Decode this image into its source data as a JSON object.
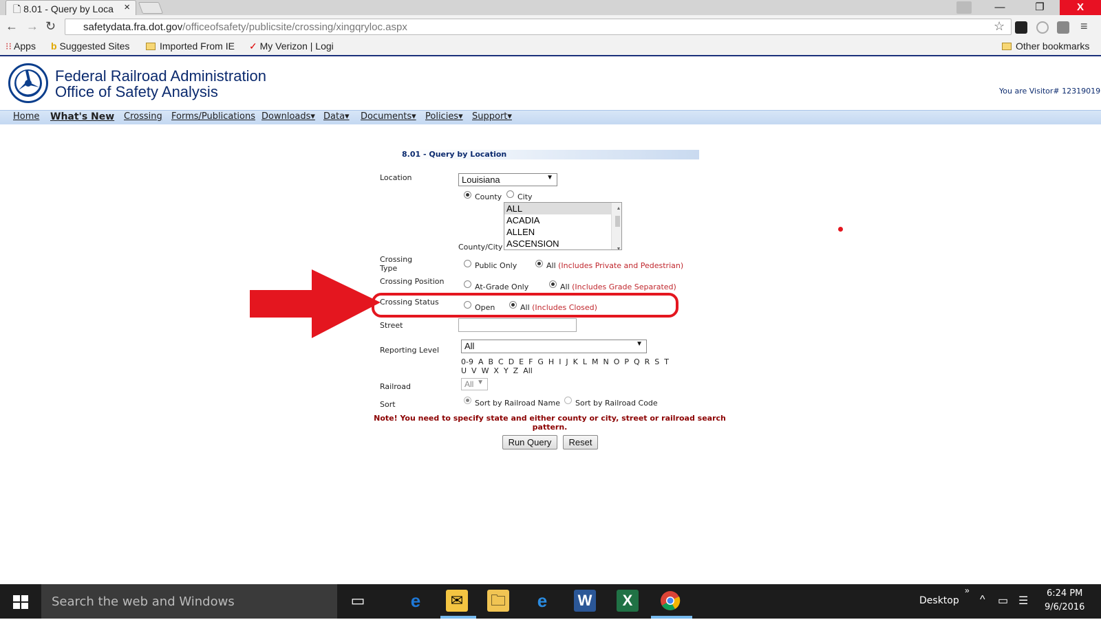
{
  "browser": {
    "tab_title": "8.01 - Query by Loca",
    "tab_close": "×",
    "url_host": "safetydata.fra.dot.gov",
    "url_path": "/officeofsafety/publicsite/crossing/xingqryloc.aspx",
    "bookmarks": [
      "Apps",
      "Suggested Sites",
      "Imported From IE",
      "My Verizon | Logi",
      "Other bookmarks"
    ],
    "win_minimize": "—",
    "win_restore": "❐",
    "win_close": "X"
  },
  "site": {
    "title_line1": "Federal Railroad Administration",
    "title_line2": "Office of Safety Analysis",
    "visitor": "You are Visitor# 12319019",
    "menu": [
      "Home",
      "What's New",
      "Crossing",
      "Forms/Publications",
      "Downloads▾",
      "Data▾",
      "Documents▾",
      "Policies▾",
      "Support▾"
    ]
  },
  "form": {
    "title": "8.01 - Query by Location",
    "location_label": "Location",
    "location_value": "Louisiana",
    "county_label": "County",
    "city_label": "City",
    "county_city_label": "County/City",
    "county_options": [
      "ALL",
      "ACADIA",
      "ALLEN",
      "ASCENSION"
    ],
    "crossing_type_label_1": "Crossing",
    "crossing_type_label_2": "Type",
    "public_only": "Public Only",
    "all_label": "All",
    "type_note": "(Includes Private and Pedestrian)",
    "crossing_position_label": "Crossing Position",
    "at_grade_only": "At-Grade Only",
    "position_note": "(Includes Grade Separated)",
    "crossing_status_label": "Crossing Status",
    "open_label": "Open",
    "status_note": "(Includes Closed)",
    "street_label": "Street",
    "reporting_level_label": "Reporting Level",
    "reporting_level_value": "All",
    "alpha_line1": "0-9  A  B  C  D  E  F  G  H  I  J  K  L  M  N  O  P  Q  R  S  T",
    "alpha_line2": "U  V  W  X  Y  Z  All",
    "railroad_label": "Railroad",
    "railroad_value": "All",
    "sort_label": "Sort",
    "sort_name": "Sort by Railroad Name",
    "sort_code": "Sort by Railroad Code",
    "note_line1": "Note! You need to specify state and either county or city, street or railroad search",
    "note_line2": "pattern.",
    "run_query": "Run Query",
    "reset": "Reset"
  },
  "taskbar": {
    "search_placeholder": "Search the web and Windows",
    "desktop": "Desktop",
    "time": "6:24 PM",
    "date": "9/6/2016"
  },
  "colors": {
    "annotation": "#e4161f",
    "nav_blue": "#0b2a6e",
    "note_red": "#8b0000"
  }
}
